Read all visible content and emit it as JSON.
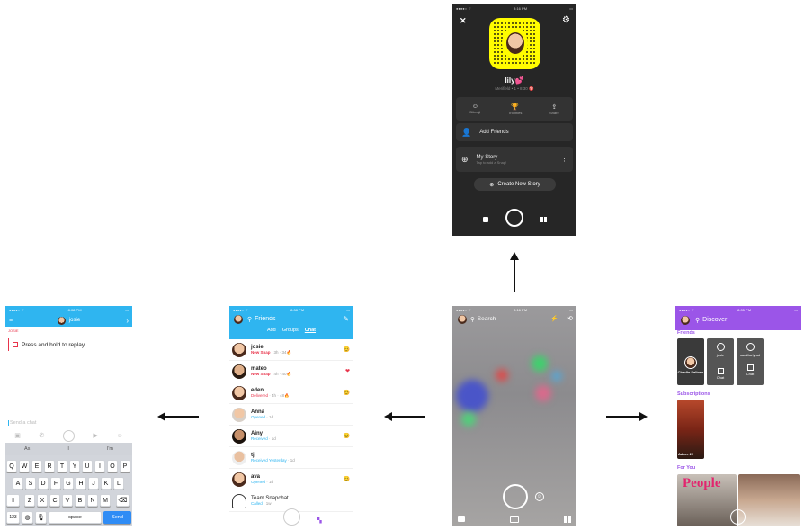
{
  "profile": {
    "status_time": "8:16 PM",
    "close_glyph": "✕",
    "name": "lily💕",
    "subline": "Merifield • 1 • 8:30  ♈",
    "actions": [
      {
        "label": "Bitmoji",
        "icon": "bitmoji-icon"
      },
      {
        "label": "Trophies",
        "icon": "trophy-icon"
      },
      {
        "label": "Share",
        "icon": "share-icon"
      }
    ],
    "add_friends": "Add Friends",
    "my_story": "My Story",
    "my_story_sub": "Tap to add a Snap!",
    "create_story": "Create New Story"
  },
  "camera": {
    "status_time": "8:16 PM",
    "search": "Search"
  },
  "friends": {
    "status_time": "8:08 PM",
    "title": "Friends",
    "tabs": [
      "Add",
      "Groups",
      "Chat"
    ],
    "active_tab": "Chat",
    "rows": [
      {
        "name": "josie",
        "status": "New Snap",
        "meta": "· 3h · 34🔥",
        "new": true,
        "emoji": "😊"
      },
      {
        "name": "mateo",
        "status": "New Snap",
        "meta": "· 4h · 40🔥",
        "new": true,
        "emoji": "❤"
      },
      {
        "name": "eden",
        "status": "Delivered",
        "meta": "· 4h · 48🔥",
        "new": false,
        "emoji": "😊"
      },
      {
        "name": "Anna",
        "status": "Opened",
        "meta": "· 1d",
        "new": false,
        "emoji": ""
      },
      {
        "name": "Ainy",
        "status": "Received",
        "meta": "· 1d",
        "new": false,
        "emoji": "😊"
      },
      {
        "name": "tj",
        "status": "Received Yesterday",
        "meta": "· 1d",
        "new": false,
        "emoji": ""
      },
      {
        "name": "ava",
        "status": "Opened",
        "meta": "· 1d",
        "new": false,
        "emoji": "😊"
      },
      {
        "name": "Team Snapchat",
        "status": "Called",
        "meta": "· 1w",
        "new": false,
        "emoji": ""
      }
    ]
  },
  "chat": {
    "status_time": "8:08 PM",
    "contact": "josie",
    "sender": "JOSIE",
    "message": "Press and hold to replay",
    "input_placeholder": "Send a chat",
    "suggestions": [
      "As",
      "I",
      "I'm"
    ],
    "keyboard_rows": [
      [
        "Q",
        "W",
        "E",
        "R",
        "T",
        "Y",
        "U",
        "I",
        "O",
        "P"
      ],
      [
        "A",
        "S",
        "D",
        "F",
        "G",
        "H",
        "J",
        "K",
        "L"
      ],
      [
        "Z",
        "X",
        "C",
        "V",
        "B",
        "N",
        "M"
      ]
    ],
    "key_123": "123",
    "key_space": "space",
    "key_send": "Send"
  },
  "discover": {
    "status_time": "8:05 PM",
    "title": "Discover",
    "friends_label": "Friends",
    "friend_cards": [
      {
        "name": "Charlie Salinas"
      },
      {
        "name": "josie"
      },
      {
        "name": "samiliarly ad"
      }
    ],
    "chat_label": "Chat",
    "subscriptions_label": "Subscriptions",
    "sub_caption": "Adore 22",
    "for_you_label": "For You",
    "people_logo": "People"
  },
  "colors": {
    "snap_yellow": "#fffc00",
    "friends_blue": "#2fb5f0",
    "discover_purple": "#9b55e8",
    "new_snap_red": "#e8344b"
  }
}
